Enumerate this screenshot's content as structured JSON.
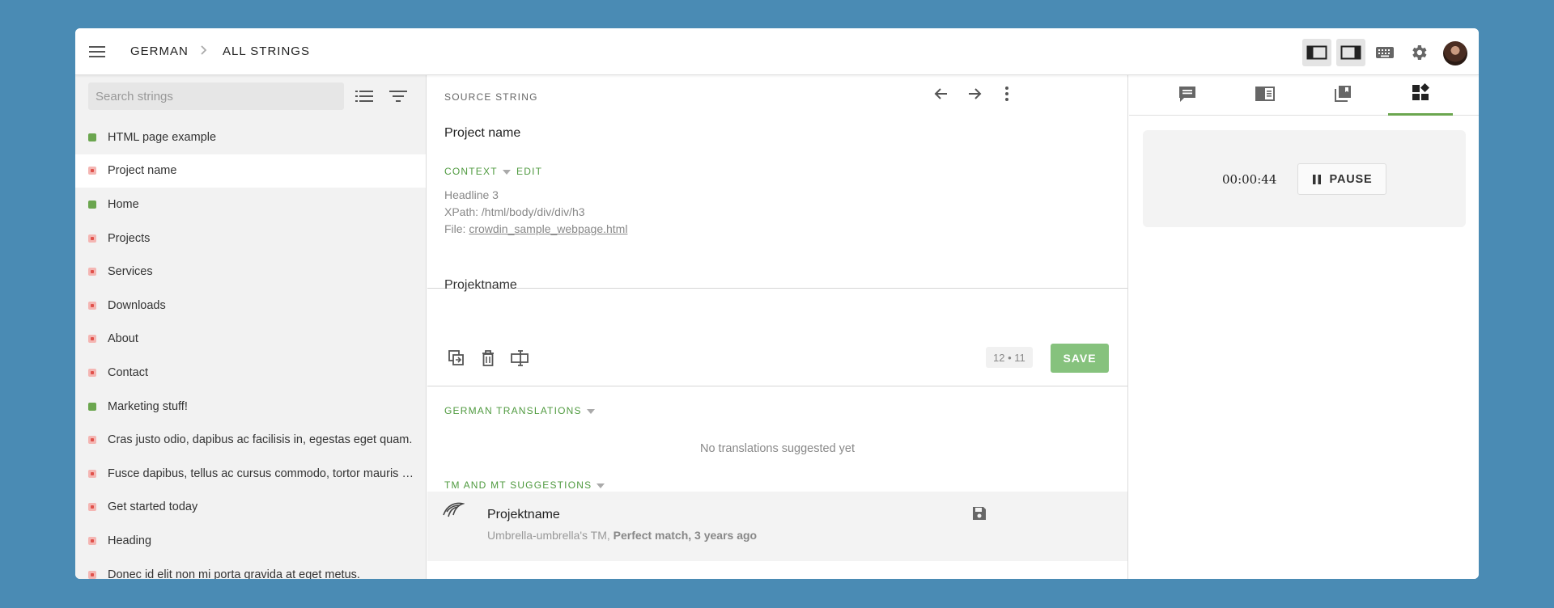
{
  "header": {
    "breadcrumb": [
      "GERMAN",
      "ALL STRINGS"
    ]
  },
  "sidebar": {
    "search_placeholder": "Search strings",
    "items": [
      {
        "label": "HTML page example",
        "status": "translated"
      },
      {
        "label": "Project name",
        "status": "untranslated",
        "selected": true
      },
      {
        "label": "Home",
        "status": "translated"
      },
      {
        "label": "Projects",
        "status": "untranslated"
      },
      {
        "label": "Services",
        "status": "untranslated"
      },
      {
        "label": "Downloads",
        "status": "untranslated"
      },
      {
        "label": "About",
        "status": "untranslated"
      },
      {
        "label": "Contact",
        "status": "untranslated"
      },
      {
        "label": "Marketing stuff!",
        "status": "translated"
      },
      {
        "label": "Cras justo odio, dapibus ac facilisis in, egestas eget quam.",
        "status": "untranslated"
      },
      {
        "label": "Fusce dapibus, tellus ac cursus commodo, tortor mauris condimentum nibh.",
        "status": "untranslated"
      },
      {
        "label": "Get started today",
        "status": "untranslated"
      },
      {
        "label": "Heading",
        "status": "untranslated"
      },
      {
        "label": "Donec id elit non mi porta gravida at eget metus.",
        "status": "untranslated"
      }
    ]
  },
  "editor": {
    "source_label": "SOURCE STRING",
    "source_text": "Project name",
    "context_label": "CONTEXT",
    "edit_label": "EDIT",
    "context_lines": {
      "headline": "Headline 3",
      "xpath": "XPath: /html/body/div/div/h3",
      "file_prefix": "File: ",
      "file_name": "crowdin_sample_webpage.html"
    },
    "translation_text": "Projektname",
    "counter": "12 • 11",
    "save_label": "SAVE",
    "translations_label": "GERMAN TRANSLATIONS",
    "no_translations": "No translations suggested yet",
    "tm_label": "TM AND MT SUGGESTIONS",
    "tm_suggestion": {
      "text": "Projektname",
      "source": "Umbrella-umbrella's TM, ",
      "match": "Perfect match, 3 years ago"
    }
  },
  "right_panel": {
    "timer": "00:00:44",
    "pause_label": "PAUSE"
  },
  "colors": {
    "background": "#4a8bb4",
    "accent_green": "#6ba64f",
    "save_green": "#86c27d",
    "untranslated_red": "#e0524c"
  }
}
